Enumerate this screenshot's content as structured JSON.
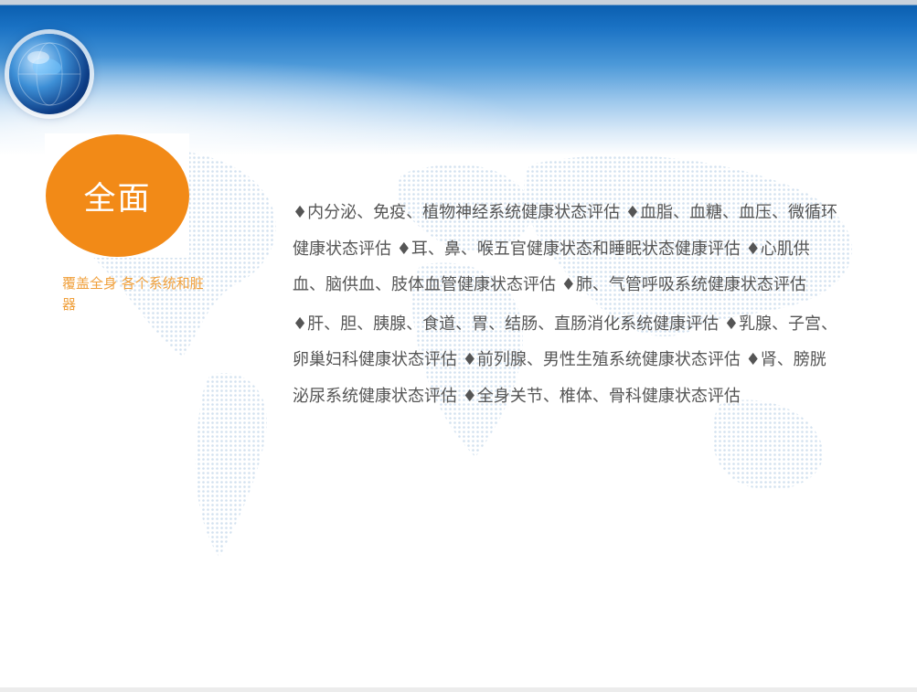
{
  "badge": {
    "title": "全面",
    "color": "#f28a17"
  },
  "caption": "覆盖全身 各个系统和脏器",
  "paragraphs": [
    "♦内分泌、免疫、植物神经系统健康状态评估 ♦血脂、血糖、血压、微循环健康状态评估 ♦耳、鼻、喉五官健康状态和睡眠状态健康评估 ♦心肌供血、脑供血、肢体血管健康状态评估 ♦肺、气管呼吸系统健康状态评估",
    "♦肝、胆、胰腺、食道、胃、结肠、直肠消化系统健康评估 ♦乳腺、子宫、卵巢妇科健康状态评估 ♦前列腺、男性生殖系统健康状态评估 ♦肾、膀胱泌尿系统健康状态评估 ♦全身关节、椎体、骨科健康状态评估"
  ],
  "colors": {
    "header_blue": "#1a72c4",
    "caption": "#f0a03c",
    "text": "#555555"
  },
  "icons": {
    "logo": "globe-icon"
  }
}
